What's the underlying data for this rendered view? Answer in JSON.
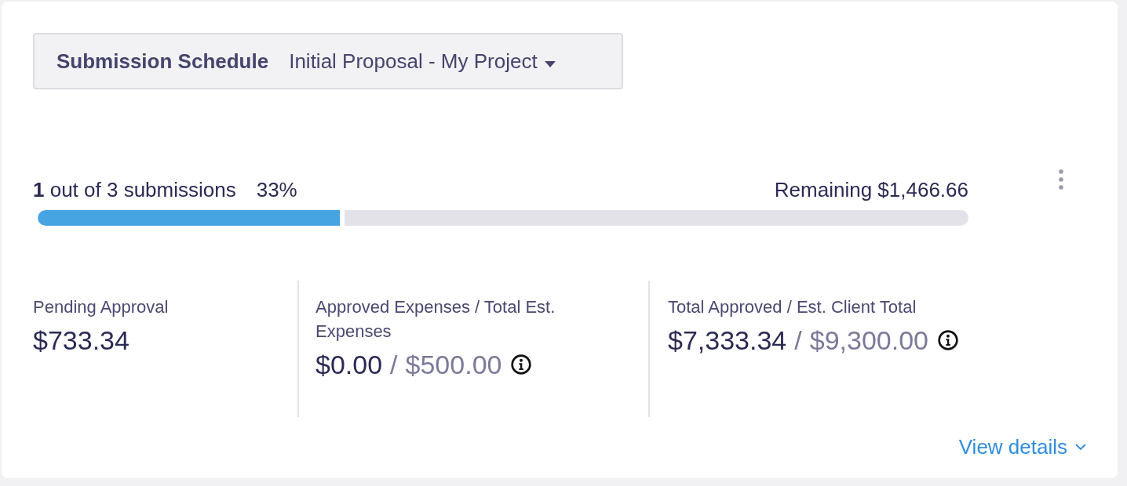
{
  "schedule": {
    "label": "Submission Schedule",
    "value": "Initial Proposal - My Project"
  },
  "progress": {
    "summary": "**1** out of 3 submissions",
    "percent": "33%",
    "remaining": "Remaining $1,466.66",
    "level": 0.33
  },
  "stats": [
    {
      "label": "Pending Approval",
      "value": "$733.34",
      "info": false
    },
    {
      "label": "Approved Expenses / Total Est. Expenses",
      "value": "$0.00",
      "separator": "/",
      "total": "$500.00",
      "info": true
    },
    {
      "label": "Total Approved / Est. Client Total",
      "value": "$7,333.34",
      "separator": "/",
      "total": "$9,300.00",
      "info": true
    }
  ],
  "link": {
    "label": "View details"
  }
}
